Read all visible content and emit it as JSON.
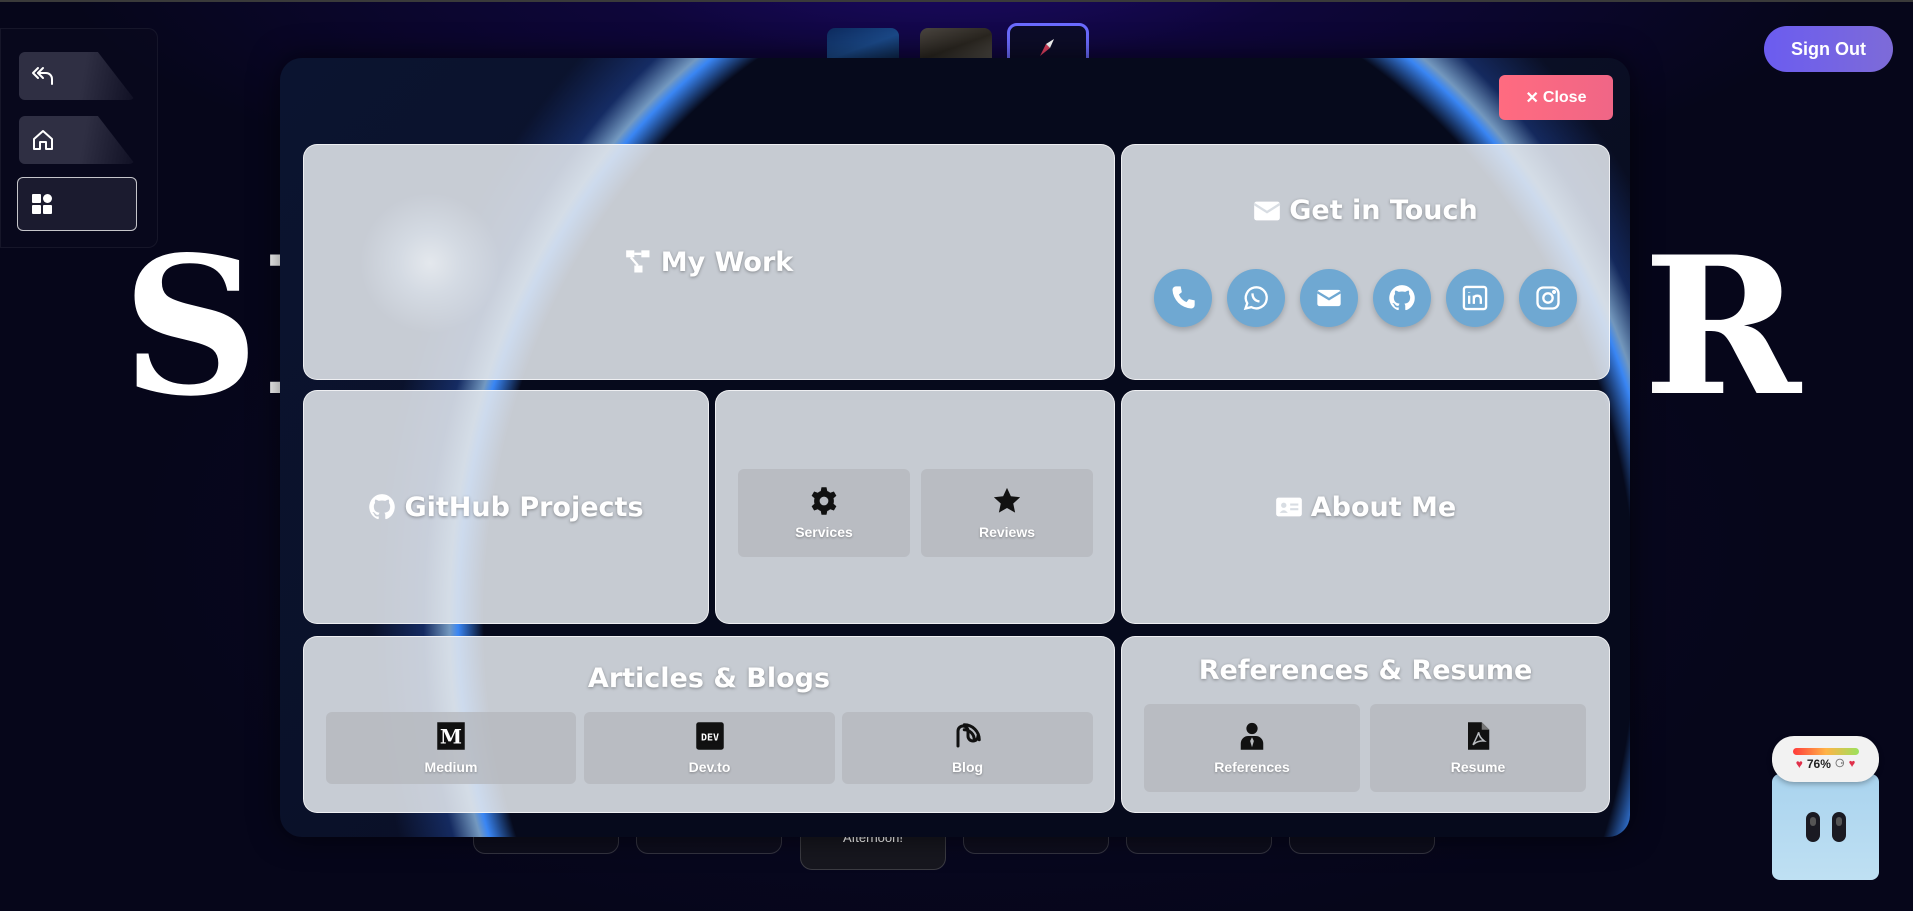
{
  "header": {
    "sign_out_label": "Sign Out"
  },
  "hero": {
    "left_text": "SE",
    "right_text": "R"
  },
  "sidebar": {
    "items": [
      {
        "name": "back",
        "icon": "reply-all-icon"
      },
      {
        "name": "home",
        "icon": "home-icon"
      },
      {
        "name": "grid",
        "icon": "grid-icon"
      }
    ]
  },
  "modal": {
    "close_label": "Close",
    "my_work": {
      "title": "My Work",
      "icon": "network-icon"
    },
    "get_in_touch": {
      "title": "Get in Touch",
      "icon": "envelope-icon",
      "socials": [
        "phone-icon",
        "whatsapp-icon",
        "email-icon",
        "github-icon",
        "linkedin-icon",
        "instagram-icon"
      ]
    },
    "github_projects": {
      "title": "GitHub Projects",
      "icon": "github-icon"
    },
    "services": {
      "label": "Services",
      "icon": "gear-icon"
    },
    "reviews": {
      "label": "Reviews",
      "icon": "star-icon"
    },
    "about_me": {
      "title": "About Me",
      "icon": "id-card-icon"
    },
    "articles": {
      "title": "Articles & Blogs",
      "items": [
        {
          "label": "Medium",
          "icon": "medium-icon"
        },
        {
          "label": "Dev.to",
          "icon": "devto-icon"
        },
        {
          "label": "Blog",
          "icon": "blog-icon"
        }
      ]
    },
    "references": {
      "title": "References & Resume",
      "items": [
        {
          "label": "References",
          "icon": "person-icon"
        },
        {
          "label": "Resume",
          "icon": "pdf-file-icon"
        }
      ]
    }
  },
  "bottom_bar": {
    "center_label": "Afternoon!"
  },
  "widget": {
    "percent": "76%"
  },
  "colors": {
    "close_button": "#f06686",
    "sign_out": "#6b5cf0",
    "social_circle": "#6fa8d2"
  }
}
